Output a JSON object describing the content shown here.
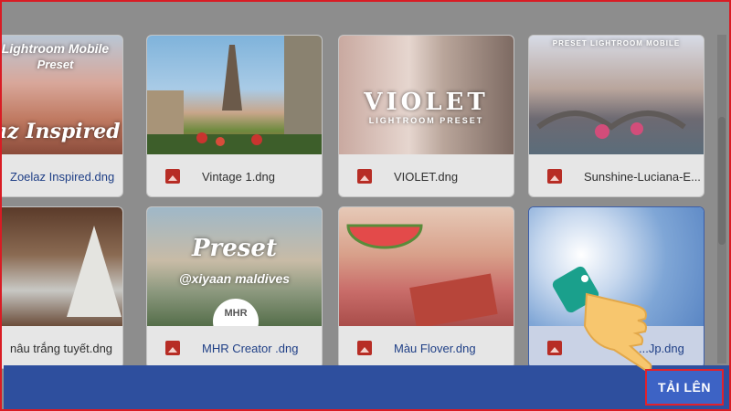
{
  "files": [
    {
      "name": "Zoelaz Inspired.dng",
      "thumb_title": "Lightroom Mobile",
      "thumb_sub": "Preset",
      "thumb_script": "laz Inspired"
    },
    {
      "name": "Vintage 1.dng"
    },
    {
      "name": "VIOLET.dng",
      "thumb_title": "VIOLET",
      "thumb_sub": "LIGHTROOM PRESET"
    },
    {
      "name": "Sunshine-Luciana-E...",
      "thumb_title": "PRESET LIGHTROOM MOBILE"
    },
    {
      "name": "nâu trắng tuyết.dng"
    },
    {
      "name": "MHR Creator .dng",
      "thumb_title": "Preset",
      "thumb_sub": "@xiyaan maldives",
      "thumb_badge": "MHR"
    },
    {
      "name": "Màu Flover.dng"
    },
    {
      "name": "...Jp.dng"
    }
  ],
  "upload_button": {
    "label": "TẢI LÊN"
  },
  "colors": {
    "bottom_bar": "#2e4f9e",
    "button": "#3d63c5",
    "highlight": "#e2212b",
    "file_icon": "#b72d25"
  }
}
